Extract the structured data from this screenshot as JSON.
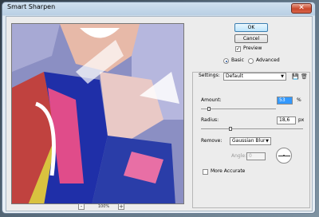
{
  "window": {
    "title": "Smart Sharpen",
    "close_label": "✕"
  },
  "buttons": {
    "ok": "OK",
    "cancel": "Cancel"
  },
  "options": {
    "preview_label": "Preview",
    "preview_checked": true,
    "mode_basic": "Basic",
    "mode_advanced": "Advanced",
    "mode_selected": "Basic"
  },
  "settings": {
    "label": "Settings:",
    "value": "Default",
    "save_icon": "save-settings-icon",
    "delete_icon": "delete-settings-icon",
    "amount_label": "Amount:",
    "amount_value": "53",
    "amount_unit": "%",
    "amount_fraction": 0.106,
    "radius_label": "Radius:",
    "radius_value": "18,6",
    "radius_unit": "px",
    "radius_fraction": 0.29,
    "remove_label": "Remove:",
    "remove_value": "Gaussian Blur",
    "angle_label": "Angle:",
    "angle_value": "0",
    "more_accurate_label": "More Accurate",
    "more_accurate_checked": false
  },
  "zoom": {
    "minus": "-",
    "level": "100%",
    "plus": "+"
  },
  "colors": {
    "accent": "#3399ff",
    "default_button": "#bee6fd"
  }
}
